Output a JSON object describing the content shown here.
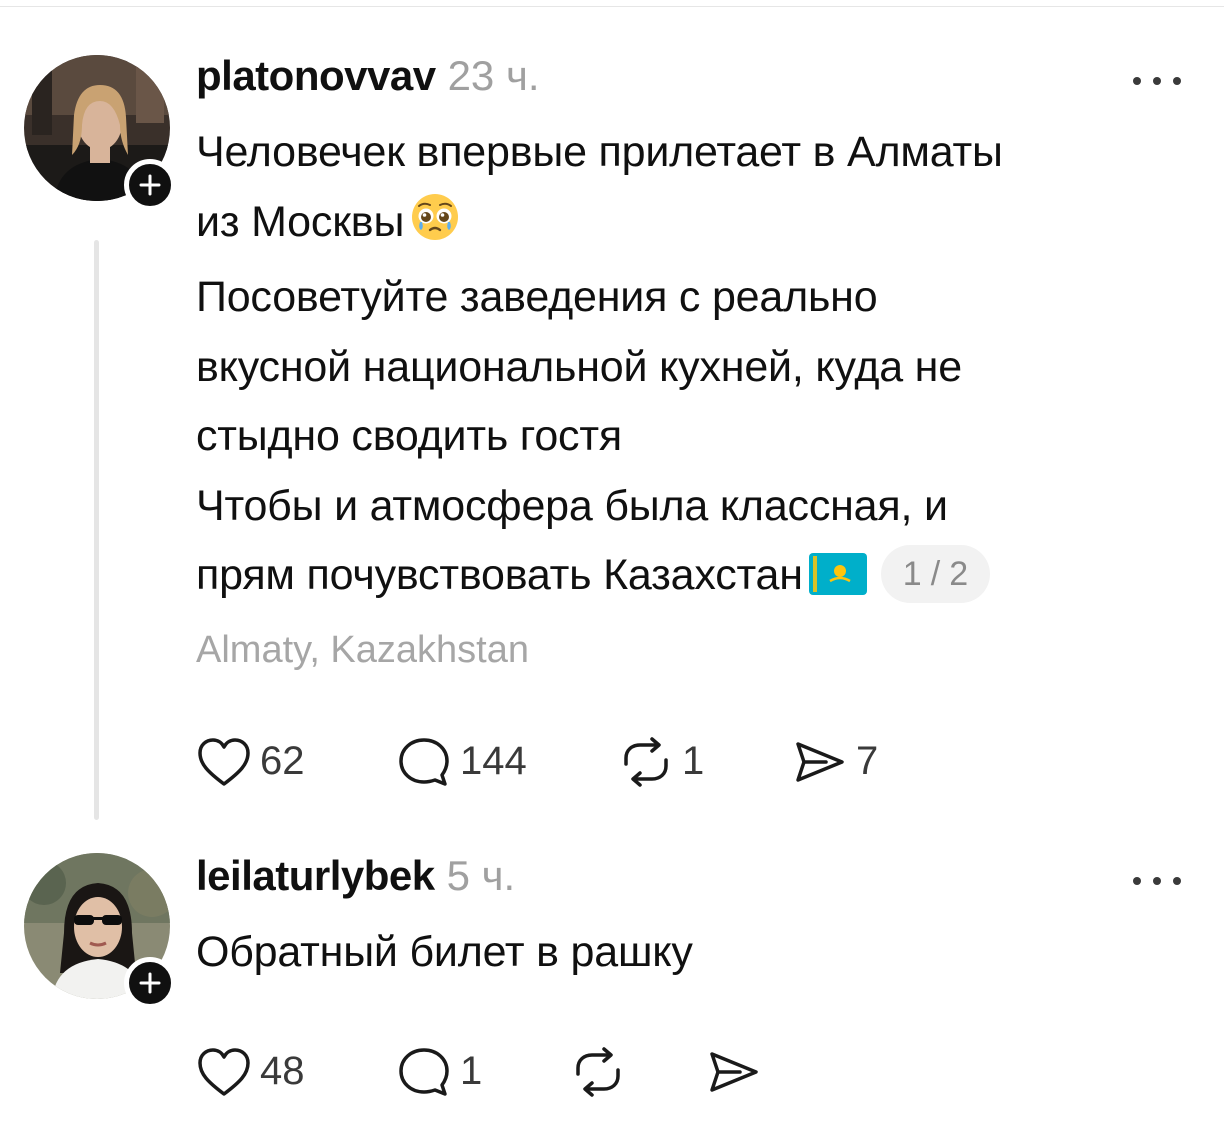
{
  "posts": [
    {
      "username": "platonovvav",
      "time": "23 ч.",
      "text_lines": [
        "Человечек впервые прилетает в Алматы",
        "из Москвы",
        "Посоветуйте заведения с реально",
        "вкусной национальной кухней, куда не",
        "стыдно сводить гостя",
        "Чтобы и атмосфера была классная, и",
        "прям почувствовать Казахстан"
      ],
      "emoji": "pleading-face",
      "flag": "kazakhstan-flag",
      "page_indicator": "1 / 2",
      "location": "Almaty, Kazakhstan",
      "likes": "62",
      "comments": "144",
      "reposts": "1",
      "shares": "7"
    },
    {
      "username": "leilaturlybek",
      "time": "5 ч.",
      "text_lines": [
        "Обратный билет в рашку"
      ],
      "likes": "48",
      "comments": "1"
    }
  ],
  "icons": {
    "like": "heart-icon",
    "comment": "comment-icon",
    "repost": "repost-icon",
    "share": "send-icon",
    "more": "more-icon",
    "follow": "plus-icon"
  },
  "colors": {
    "text": "#101010",
    "muted": "#a0a0a0",
    "thread_line": "#e5e5e5",
    "flag_blue": "#00AFCA",
    "flag_gold": "#FEC50C"
  }
}
